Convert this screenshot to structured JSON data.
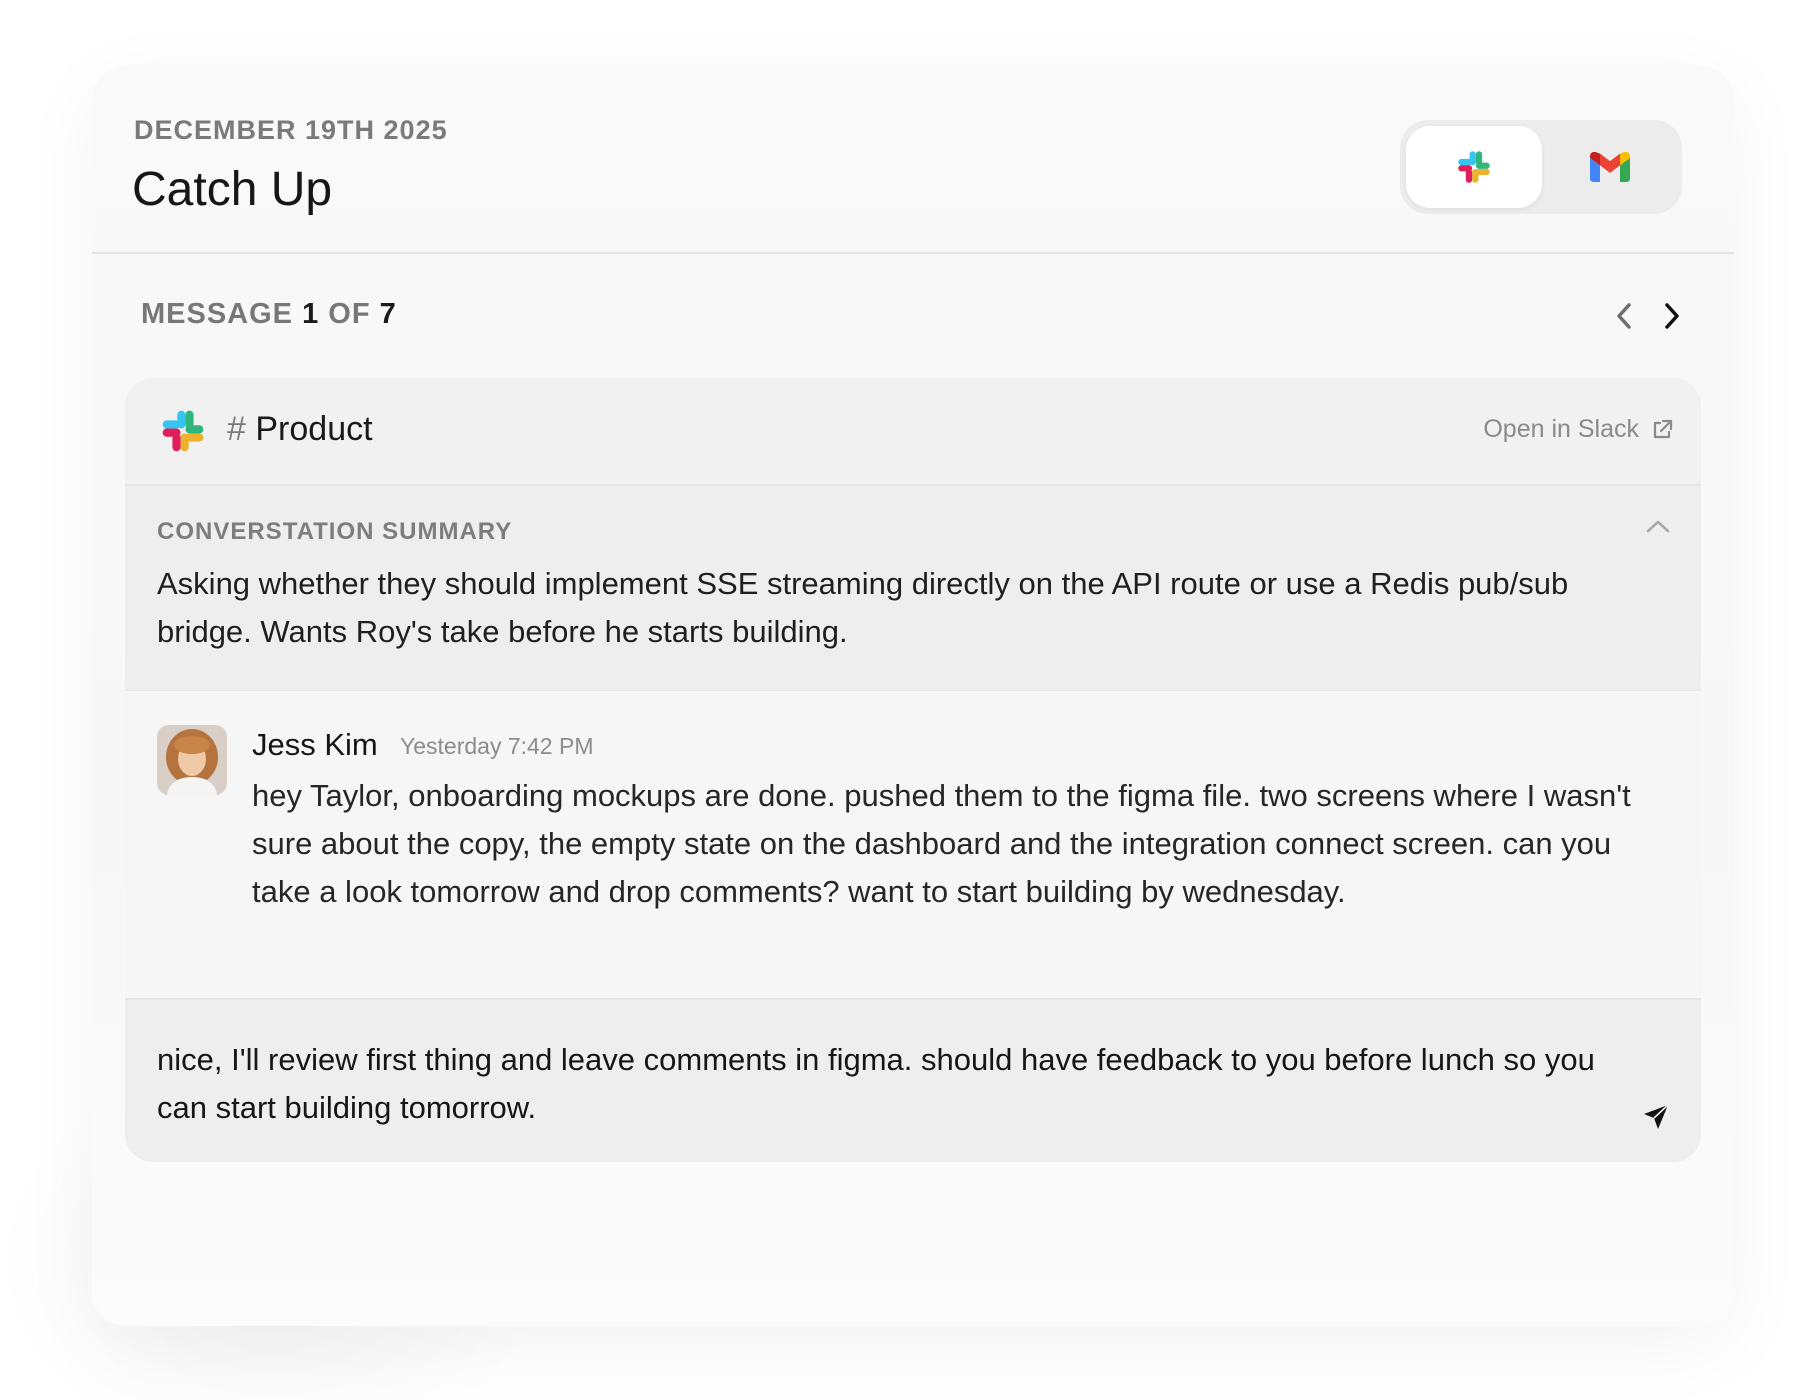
{
  "header": {
    "date": "DECEMBER 19TH 2025",
    "title": "Catch Up",
    "sources": [
      {
        "name": "Slack",
        "icon": "slack-icon",
        "active": true
      },
      {
        "name": "Gmail",
        "icon": "gmail-icon",
        "active": false
      }
    ]
  },
  "pager": {
    "label": "MESSAGE",
    "current": "1",
    "of": "OF",
    "total": "7"
  },
  "channel": {
    "hash": "#",
    "name": "Product",
    "open_link": "Open in Slack"
  },
  "summary": {
    "label": "CONVERSTATION SUMMARY",
    "text": "Asking whether they should implement SSE streaming directly on the API route or use a Redis pub/sub bridge. Wants Roy's take before he starts building."
  },
  "message": {
    "author": "Jess Kim",
    "timestamp": "Yesterday 7:42 PM",
    "text": "hey Taylor, onboarding mockups are done. pushed them to the figma file. two screens where I wasn't sure about the copy, the empty state on the dashboard and the integration connect screen. can you take a look tomorrow and drop comments? want to start building by wednesday."
  },
  "reply": {
    "text": "nice, I'll review first thing and leave comments in figma. should have feedback to you before lunch so you can start building tomorrow."
  },
  "colors": {
    "slack_red": "#E01E5A",
    "slack_blue": "#36C5F0",
    "slack_green": "#2EB67D",
    "slack_yellow": "#ECB22E",
    "gmail_red": "#EA4335",
    "gmail_blue": "#4285F4",
    "gmail_green": "#34A853",
    "gmail_yellow": "#FBBC04"
  }
}
